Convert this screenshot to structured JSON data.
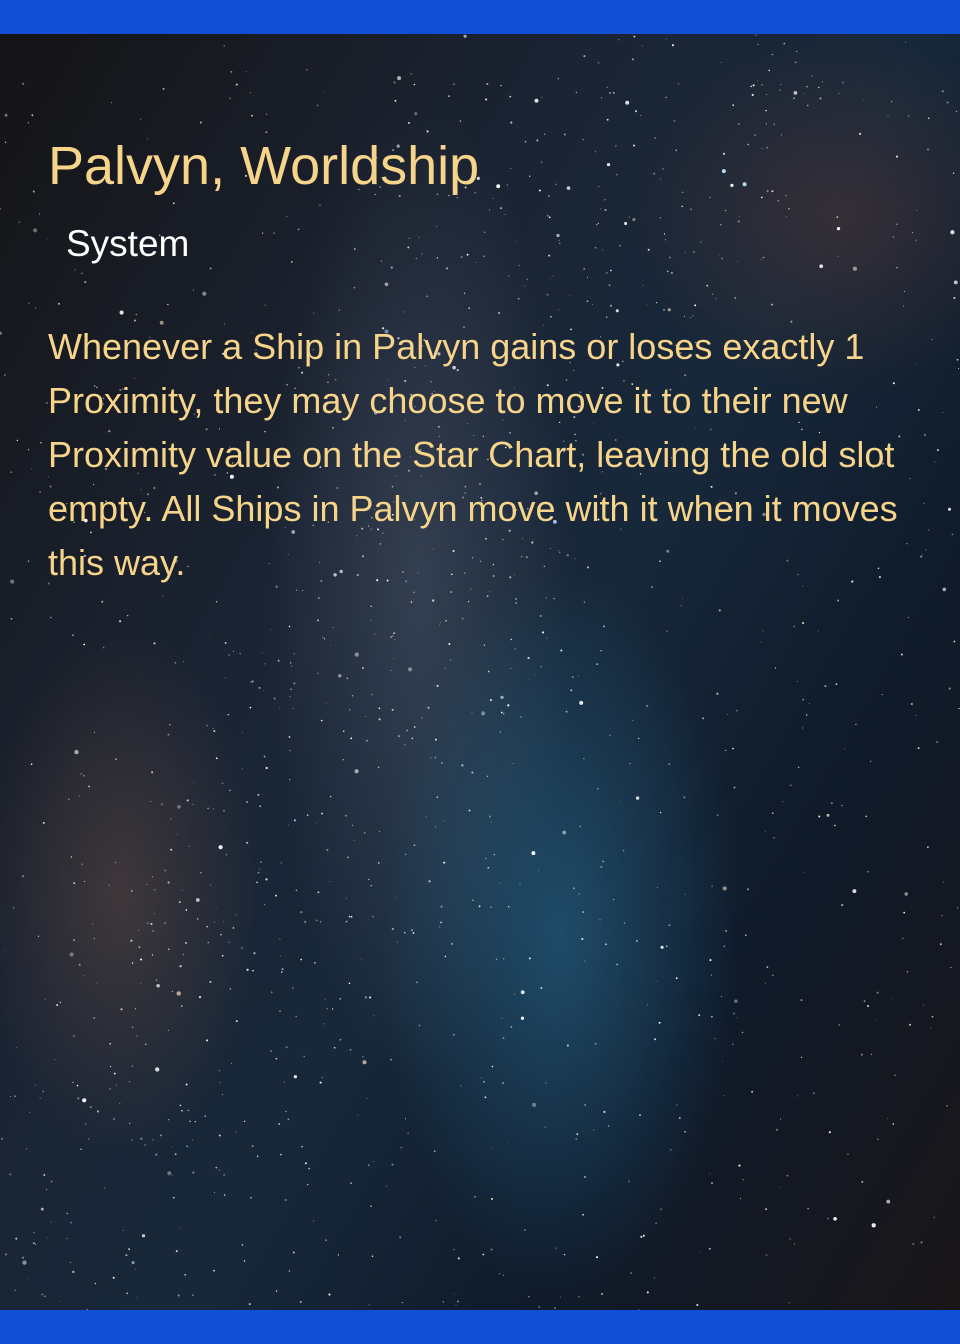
{
  "card": {
    "title": "Palvyn, Worldship",
    "type": "System",
    "text": "Whenever a Ship in Palvyn gains or loses exactly 1 Proximity, they may choose to move it to their new Proximity value on the Star Chart, leaving the old slot empty. All Ships in Palvyn move with it when it moves this way."
  },
  "colors": {
    "frame": "#1150d6",
    "title": "#f6d48a",
    "subtitle": "#ffffff",
    "body": "#f6d48a"
  }
}
